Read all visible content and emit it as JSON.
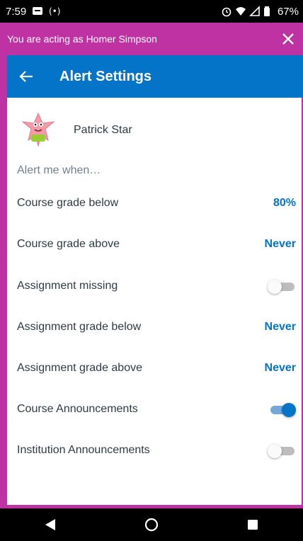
{
  "status_bar": {
    "time": "7:59",
    "battery": "67%"
  },
  "banner": {
    "text": "You are acting as Homer Simpson"
  },
  "app_bar": {
    "title": "Alert Settings"
  },
  "student": {
    "name": "Patrick Star"
  },
  "alerts": {
    "header": "Alert me when…",
    "rows": [
      {
        "label": "Course grade below",
        "value": "80%"
      },
      {
        "label": "Course grade above",
        "value": "Never"
      },
      {
        "label": "Assignment missing",
        "toggle": false
      },
      {
        "label": "Assignment grade below",
        "value": "Never"
      },
      {
        "label": "Assignment grade above",
        "value": "Never"
      },
      {
        "label": "Course Announcements",
        "toggle": true
      },
      {
        "label": "Institution Announcements",
        "toggle": false
      }
    ]
  },
  "colors": {
    "accent_blue": "#0374c8",
    "masquerade_magenta": "#bf32a4"
  }
}
